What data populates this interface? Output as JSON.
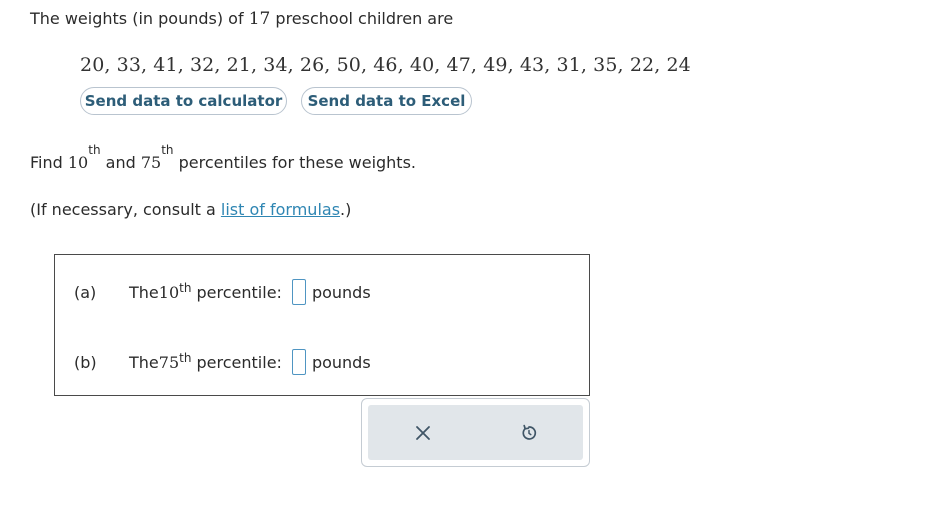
{
  "intro": {
    "prefix": "The weights (in pounds) of ",
    "count": "17",
    "suffix": " preschool children are"
  },
  "data_values": "20, 33, 41, 32, 21, 34, 26, 50, 46, 40, 47, 49, 43, 31, 35, 22, 24",
  "buttons": {
    "calculator": "Send data to calculator",
    "excel": "Send data to Excel"
  },
  "question": {
    "find": "Find ",
    "p1": "10",
    "p1_ord": "th",
    "and": " and ",
    "p2": "75",
    "p2_ord": "th",
    "rest": " percentiles for these weights."
  },
  "hint": {
    "prefix": "(If necessary, consult a ",
    "link": "list of formulas",
    "suffix": ".)"
  },
  "answers": {
    "a": {
      "part": "(a)",
      "the": "The ",
      "num": "10",
      "ord": "th",
      "label": " percentile:",
      "unit": "pounds",
      "value": ""
    },
    "b": {
      "part": "(b)",
      "the": "The ",
      "num": "75",
      "ord": "th",
      "label": " percentile:",
      "unit": "pounds",
      "value": ""
    }
  },
  "actions": {
    "clear_icon": "close-icon",
    "undo_icon": "undo-icon"
  },
  "colors": {
    "button_text": "#2d5d78",
    "link": "#2f86b3",
    "input_border": "#4f95c2",
    "panel_bg": "#e1e6ea"
  }
}
